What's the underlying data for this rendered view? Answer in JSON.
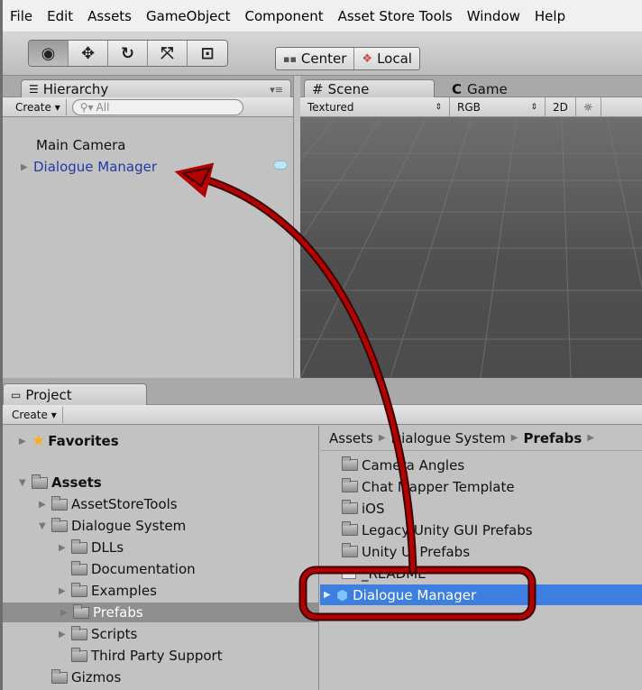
{
  "menu": [
    "File",
    "Edit",
    "Assets",
    "GameObject",
    "Component",
    "Asset Store Tools",
    "Window",
    "Help"
  ],
  "toolbar": {
    "tools": [
      {
        "name": "view-tool",
        "glyph": "◉"
      },
      {
        "name": "move-tool",
        "glyph": "✥"
      },
      {
        "name": "rotate-tool",
        "glyph": "↻"
      },
      {
        "name": "scale-tool",
        "glyph": "⤧"
      },
      {
        "name": "rect-tool",
        "glyph": "⊡"
      }
    ],
    "pivot": "Center",
    "space": "Local"
  },
  "hierarchy": {
    "tab": "Hierarchy",
    "create": "Create",
    "search": "All",
    "items": [
      "Main Camera",
      "Dialogue Manager"
    ]
  },
  "scene": {
    "tab_scene": "Scene",
    "tab_game": "Game",
    "shading": "Textured",
    "render_mode": "RGB",
    "mode_2d": "2D"
  },
  "project": {
    "tab": "Project",
    "create": "Create",
    "tree": {
      "favorites": "Favorites",
      "assets": "Assets",
      "items": [
        "AssetStoreTools",
        "Dialogue System",
        "DLLs",
        "Documentation",
        "Examples",
        "Prefabs",
        "Scripts",
        "Third Party Support",
        "Gizmos"
      ]
    },
    "breadcrumb": [
      "Assets",
      "Dialogue System",
      "Prefabs"
    ],
    "files": [
      "Camera Angles",
      "Chat Mapper Template",
      "iOS",
      "Legacy Unity GUI Prefabs",
      "Unity UI Prefabs",
      "_README",
      "Dialogue Manager"
    ]
  },
  "colors": {
    "highlight_ring": "#b30000",
    "selection": "#3d7fe0",
    "hierarchy_prefab_text": "#1f3aa6"
  }
}
